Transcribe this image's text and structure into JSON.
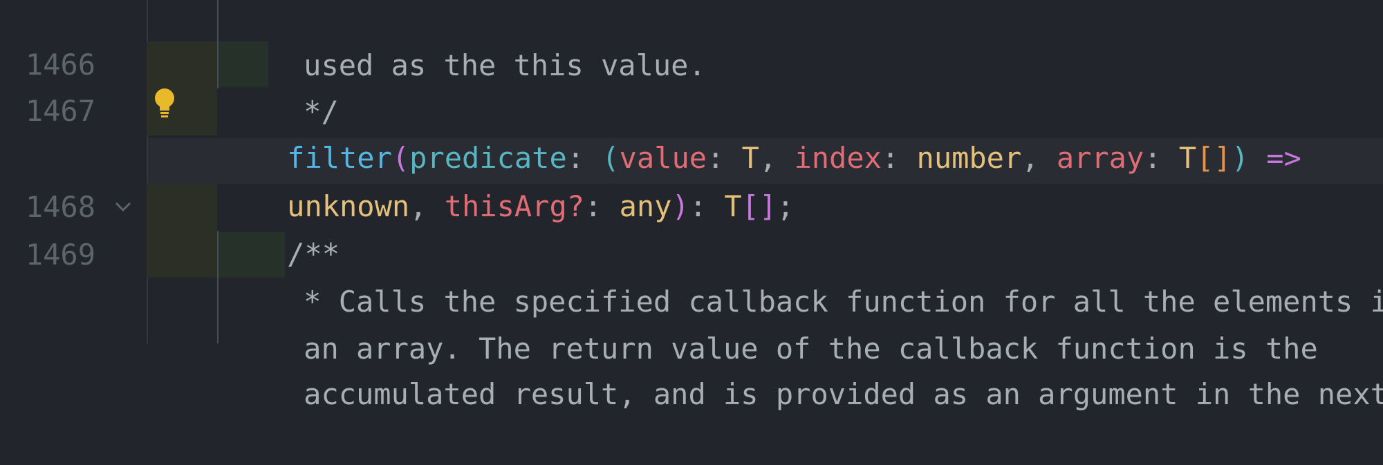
{
  "gutter": {
    "line_numbers": [
      "1466",
      "1467",
      "1468",
      "1469"
    ],
    "fold_icon": "chevron-down-icon",
    "intention_icon": "lightbulb-icon"
  },
  "code": {
    "line0": {
      "comment": "used as the this value."
    },
    "line1466": {
      "comment": "*/"
    },
    "line1467": {
      "fn": "filter",
      "open1": "(",
      "predicate": "predicate",
      "colon1": ": ",
      "open2": "(",
      "value": "value",
      "colon2": ": ",
      "t1": "T",
      "comma1": ", ",
      "index": "index",
      "colon3": ": ",
      "number": "number",
      "comma2": ", ",
      "array": "array",
      "colon4": ": ",
      "t2": "T",
      "brackets1": "[]",
      "close2": ")",
      "arrow": " =>"
    },
    "line1467b": {
      "unknown": "unknown",
      "comma3": ", ",
      "thisArg": "thisArg",
      "optional": "?",
      "colon5": ": ",
      "any": "any",
      "close1": ")",
      "colon6": ": ",
      "t3": "T",
      "brackets2": "[]",
      "semi": ";"
    },
    "line1468": {
      "comment": "/**"
    },
    "line1469": {
      "comment": "* Calls the specified callback function for all the elements in"
    },
    "line1469b": {
      "comment": "an array. The return value of the callback function is the"
    },
    "line1469c": {
      "comment": "accumulated result, and is provided as an argument in the next"
    }
  },
  "colors": {
    "background": "#22252b",
    "function": "#56b6e3",
    "parameter": "#e06c75",
    "type": "#e5c07b",
    "keyword": "#c678dd",
    "comment": "#a9adb5",
    "bulb": "#e8b92a"
  }
}
